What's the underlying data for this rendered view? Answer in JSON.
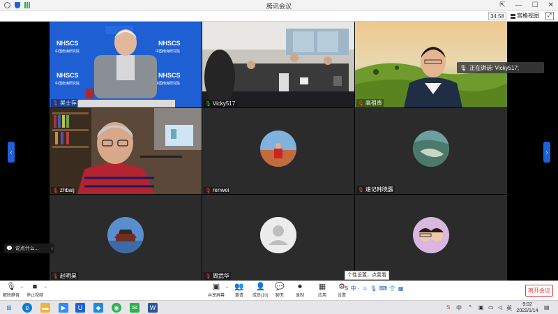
{
  "window": {
    "title": "腾讯会议"
  },
  "topbar": {
    "elapsed": "34:58",
    "view_label": "宫格视图"
  },
  "colors": {
    "accent": "#1e62d8",
    "leave": "#e04040"
  },
  "participants": [
    {
      "name": "吴士存",
      "mic": "muted"
    },
    {
      "name": "Vicky517",
      "mic": "active"
    },
    {
      "name": "高祖贵",
      "mic": "muted"
    },
    {
      "name": "zhbaij",
      "mic": "muted"
    },
    {
      "name": "renwei",
      "mic": "muted"
    },
    {
      "name": "速记韩晓露",
      "mic": "muted"
    },
    {
      "name": "赵明昊",
      "mic": "muted"
    },
    {
      "name": "周武华",
      "mic": "muted"
    },
    {
      "name": "",
      "mic": "none"
    }
  ],
  "banners": {
    "nhscs": "NHSCS",
    "nhscs_cn": "中国南海研究院"
  },
  "speaking": {
    "text": "正在讲话: Vicky517;"
  },
  "chat": {
    "placeholder": "说点什么..."
  },
  "toolbar": {
    "unmute": "解除静音",
    "stop_video": "停止视频",
    "share": "共享屏幕",
    "invite": "邀请",
    "members": "成员(10)",
    "chat": "聊天",
    "record": "录制",
    "apps": "应用",
    "settings": "设置",
    "leave": "离开会议"
  },
  "tooltip": {
    "text": "个性设置，点我看看"
  },
  "ime": {
    "lang": "中"
  },
  "taskbar": {
    "time": "9:02",
    "date": "2022/1/14"
  }
}
